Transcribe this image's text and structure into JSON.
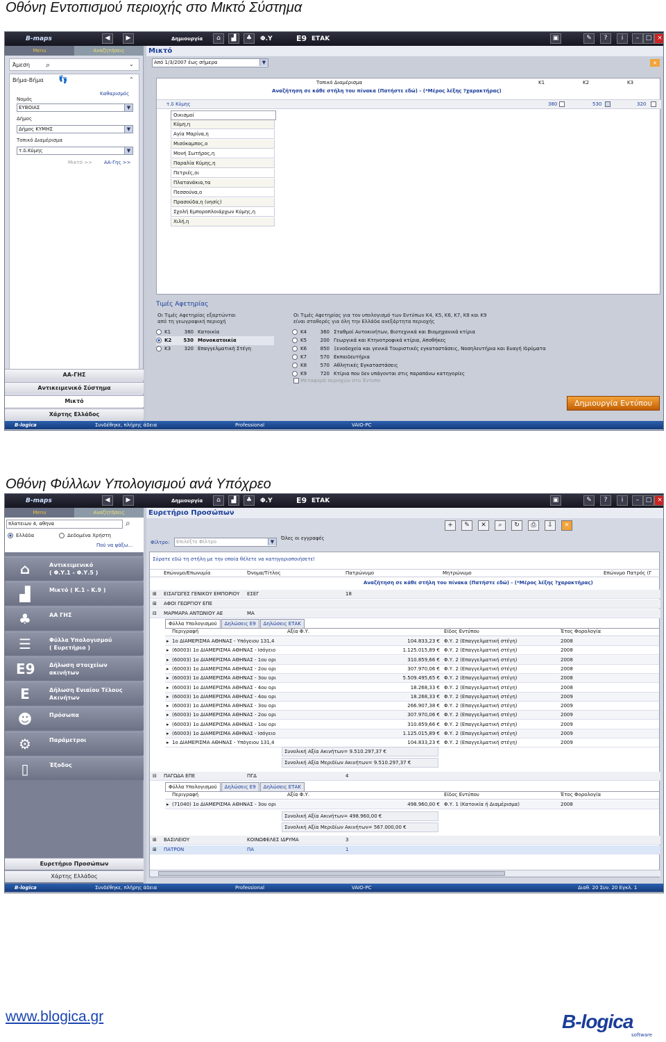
{
  "captions": {
    "first": "Οθόνη  Εντοπισμού περιοχής στο Μικτό Σύστημα",
    "second": "Οθόνη Φύλλων Υπολογισμού ανά Υπόχρεο"
  },
  "app": {
    "logo": "B-maps",
    "create_label": "Δημιουργία",
    "toolbar_fy": "Φ.Υ",
    "toolbar_e9": "E9",
    "toolbar_etak": "ΕΤΑΚ",
    "tabs": [
      "Menu",
      "Αναζητήσεις"
    ]
  },
  "screen1": {
    "left": {
      "search_mode": "Άμεση",
      "step_mode": "Βήμα-Βήμα",
      "clear": "Καθαρισμός",
      "nomos_label": "Νομός",
      "nomos_value": "ΕΥΒΟΙΑΣ",
      "dimos_label": "Δήμος",
      "dimos_value": "Δήμος ΚΥΜΗΣ",
      "td_label": "Τοπικό Διαμέρισμα",
      "td_value": "τ.δ.Κύμης",
      "link_mikto": "Μικτό >>",
      "link_aa": "ΑΑ-Γης >>",
      "nav": [
        "ΑΑ-ΓΗΣ",
        "Αντικειμενικό Σύστημα",
        "Μικτό",
        "Χάρτης Ελλάδος"
      ]
    },
    "main": {
      "title": "Μικτό",
      "period": "Από 1/3/2007 έως σήμερα",
      "col_td": "Τοπικό Διαμέρισμα",
      "col_k1": "K1",
      "col_k2": "K2",
      "col_k3": "K3",
      "search_hint": "Αναζήτηση σε κάθε στήλη του πίνακα (Πατήστε εδώ) - (*Μέρος λέξης ?χαρακτήρας)",
      "group": "τ.δ Κύμης",
      "v1": "380",
      "v2": "530",
      "v3": "320",
      "settlements_header": "Οικισμοί",
      "settlements": [
        "Κύμη,η",
        "Αγία Μαρίνα,η",
        "Μισόκαμπος,ο",
        "Μονή Σωτήρος,η",
        "Παραλία Κύμης,η",
        "Πετριές,οι",
        "Πλατανάκια,τα",
        "Πεσσούνα,ο",
        "Πρασούδα,η (νησίς)",
        "Σχολή Εμποροπλοιάρχων Κύμης,η",
        "Χιλή,η"
      ],
      "values_title": "Τιμές Αφετηρίας",
      "values_note_left": "Οι Τιμές Αφετηρίας εξαρτώνται\nαπό τη γεωγραφική περιοχή",
      "values_note_right": "Οι Τιμές Αφετηρίας για τον υπολογισμό των Εντύπων Κ4, Κ5, Κ6, Κ7, Κ8 και Κ9\nείναι σταθερές για όλη την Ελλάδα ανεξάρτητα περιοχής",
      "left_values": [
        {
          "code": "K1",
          "val": "380",
          "desc": "Κατοικία"
        },
        {
          "code": "K2",
          "val": "530",
          "desc": "Μονοκατοικία"
        },
        {
          "code": "K3",
          "val": "320",
          "desc": "Επαγγελματική Στέγη"
        }
      ],
      "right_values": [
        {
          "code": "K4",
          "val": "360",
          "desc": "Σταθμοί Αυτοκινήτων, Βιοτεχνικά και Βιομηχανικά κτίρια"
        },
        {
          "code": "K5",
          "val": "200",
          "desc": "Γεωργικά και Κτηνοτροφικά κτίρια, Αποθήκες"
        },
        {
          "code": "K6",
          "val": "850",
          "desc": "Ξενοδοχεία και γενικά Τουριστικές εγκαταστάσεις, Νοσηλευτήρια και Ευαγή Ιδρύματα"
        },
        {
          "code": "K7",
          "val": "570",
          "desc": "Εκπαιδευτήρια"
        },
        {
          "code": "K8",
          "val": "570",
          "desc": "Αθλητικές Εγκαταστάσεις"
        },
        {
          "code": "K9",
          "val": "720",
          "desc": "Κτίρια που δεν υπάγονται στις παραπάνω κατηγορίες"
        }
      ],
      "transfer": "Μεταφορά περιοχών στο Έντυπο",
      "create_form": "Δημιουργία Εντύπου"
    }
  },
  "status": {
    "brand": "B-logica",
    "conn": "Συνδέθηκε, πλήρης άδεια",
    "edition": "Professional",
    "pc": "VAIO-PC",
    "counts": "Διαθ. 20 Συν. 20 Εγκλ. 1"
  },
  "screen2": {
    "left": {
      "address": "πλατειων 4, αθηνα",
      "opt1": "Ελλάδα",
      "opt2": "Δεδομένα Χρήστη",
      "where": "Πού να ψάξω...",
      "nav": [
        {
          "icon": "⌂",
          "name": "objective",
          "text": "Αντικειμενικό\n( Φ.Υ.1 - Φ.Υ.5 )"
        },
        {
          "icon": "▟",
          "name": "mixed",
          "text": "Μικτό   ( K.1 - K.9 )"
        },
        {
          "icon": "♣",
          "name": "aa-gis",
          "text": "ΑΑ ΓΗΣ"
        },
        {
          "icon": "☰",
          "name": "sheets",
          "text": "Φύλλα Υπολογισμού\n( Ευρετήριο )"
        },
        {
          "icon": "E9",
          "name": "e9",
          "text": "Δήλωση στοιχείων\nακινήτων"
        },
        {
          "icon": "E",
          "name": "etak",
          "text": "Δήλωση Ενιαίου Τέλους\nΑκινήτων"
        },
        {
          "icon": "☻",
          "name": "persons",
          "text": "Πρόσωπα"
        },
        {
          "icon": "⚙",
          "name": "params",
          "text": "Παράμετροι"
        },
        {
          "icon": "▯",
          "name": "exit",
          "text": "Έξοδος"
        }
      ],
      "bottom1": "Ευρετήριο Προσώπων",
      "bottom2": "Χάρτης Ελλάδος"
    },
    "main": {
      "title": "Ευρετήριο Προσώπων",
      "filter_label": "Φίλτρο:",
      "filter_placeholder": "Επιλέξτε Φίλτρο",
      "all_records": "Όλες οι εγγραφές",
      "group_hint": "Σύρατε εδώ τη στήλη με την οποία θέλετε να κατηγοριοποιήσετε!",
      "cols": [
        "Επώνυμο/Επωνυμία",
        "Όνομα/Τίτλος",
        "Πατρώνυμο",
        "Μητρώνυμο",
        "Επώνυμο Πατρός (Γ"
      ],
      "search_hint": "Αναζήτηση σε κάθε στήλη του πίνακα (Πατήστε εδώ) - (*Μέρος λέξης ?χαρακτήρας)",
      "persons": [
        {
          "name": "ΕΙΣΑΓΩΓΕΣ ΓΕΝΙΚΟΥ ΕΜΠΟΡΙΟΥ",
          "title": "ΕΣΕΓ",
          "count": "18"
        },
        {
          "name": "ΑΦΟΙ ΓΕΩΡΓΙΟΥ ΕΠΕ",
          "title": "",
          "count": ""
        },
        {
          "name": "ΜΑΡΜΑΡΑ ΑΝΤΩΝΙΟΥ ΑΕ",
          "title": "ΜΑ",
          "count": ""
        }
      ],
      "subtabs": [
        "Φύλλα Υπολογισμού",
        "Δηλώσεις Ε9",
        "Δηλώσεις ΕΤΑΚ"
      ],
      "subcols": [
        "Περιγραφή",
        "Αξία Φ.Υ.",
        "Είδος Εντύπου",
        "Έτος Φορολογία"
      ],
      "sheets": [
        [
          "1ο ΔΙΑΜΕΡΙΣΜΑ ΑΘΗΝΑΣ - Υπόγειου 131,4",
          "104.833,23 €",
          "Φ.Υ. 2 (Επαγγελματική στέγη)",
          "2008"
        ],
        [
          "(60003) 1ο ΔΙΑΜΕΡΙΣΜΑ ΑΘΗΝΑΣ - Ισόγειο",
          "1.125.015,89 €",
          "Φ.Υ. 2 (Επαγγελματική στέγη)",
          "2008"
        ],
        [
          "(60003) 1ο ΔΙΑΜΕΡΙΣΜΑ ΑΘΗΝΑΣ - 1ου ορι",
          "310.859,66 €",
          "Φ.Υ. 2 (Επαγγελματική στέγη)",
          "2008"
        ],
        [
          "(60003) 1ο ΔΙΑΜΕΡΙΣΜΑ ΑΘΗΝΑΣ - 2ου ορι",
          "307.970,06 €",
          "Φ.Υ. 2 (Επαγγελματική στέγη)",
          "2008"
        ],
        [
          "(60003) 1ο ΔΙΑΜΕΡΙΣΜΑ ΑΘΗΝΑΣ - 3ου ορι",
          "5.509.495,65 €",
          "Φ.Υ. 2 (Επαγγελματική στέγη)",
          "2008"
        ],
        [
          "(60003) 1ο ΔΙΑΜΕΡΙΣΜΑ ΑΘΗΝΑΣ - 4ου ορι",
          "18.268,33 €",
          "Φ.Υ. 2 (Επαγγελματική στέγη)",
          "2008"
        ],
        [
          "(60003) 1ο ΔΙΑΜΕΡΙΣΜΑ ΑΘΗΝΑΣ - 4ου ορι",
          "18.268,33 €",
          "Φ.Υ. 2 (Επαγγελματική στέγη)",
          "2009"
        ],
        [
          "(60003) 1ο ΔΙΑΜΕΡΙΣΜΑ ΑΘΗΝΑΣ - 3ου ορι",
          "266.907,38 €",
          "Φ.Υ. 2 (Επαγγελματική στέγη)",
          "2009"
        ],
        [
          "(60003) 1ο ΔΙΑΜΕΡΙΣΜΑ ΑΘΗΝΑΣ - 2ου ορι",
          "307.970,06 €",
          "Φ.Υ. 2 (Επαγγελματική στέγη)",
          "2009"
        ],
        [
          "(60003) 1ο ΔΙΑΜΕΡΙΣΜΑ ΑΘΗΝΑΣ - 1ου ορι",
          "310.859,66 €",
          "Φ.Υ. 2 (Επαγγελματική στέγη)",
          "2009"
        ],
        [
          "(60003) 1ο ΔΙΑΜΕΡΙΣΜΑ ΑΘΗΝΑΣ - Ισόγειο",
          "1.125.015,89 €",
          "Φ.Υ. 2 (Επαγγελματική στέγη)",
          "2009"
        ],
        [
          "1ο ΔΙΑΜΕΡΙΣΜΑ ΑΘΗΝΑΣ - Υπόγειου 131,4",
          "104.833,23 €",
          "Φ.Υ. 2 (Επαγγελματική στέγη)",
          "2009"
        ]
      ],
      "total1": "Συνολική Αξία Ακινήτων= 9.510.297,37 €",
      "total2": "Συνολική Αξία Μεριδίων Ακινήτων= 9.510.297,37 €",
      "person4": {
        "name": "ΠΑΓΩΔΑ ΕΠΕ",
        "title": "ΠΓΔ",
        "count": "4"
      },
      "sheet2": [
        "(71040) 1ο ΔΙΑΜΕΡΙΣΜΑ ΑΘΗΝΑΣ - 3ου ορι",
        "498.960,00 €",
        "Φ.Υ. 1 (Κατοικία ή Διαμέρισμα)",
        "2008"
      ],
      "total3": "Συνολική Αξία Ακινήτων= 498.960,00 €",
      "total4": "Συνολική Αξία Μεριδίων Ακινήτων= 567.000,00 €",
      "person5": {
        "name": "ΒΑΣΙΛΕΙΟΥ",
        "title": "ΚΟΙΝΩΦΕΛΕΣ ΙΔΡΥΜΑ",
        "count": "3"
      },
      "person6": {
        "name": "ΠΑΤΡΟΝ",
        "title": "ΠΑ",
        "count": "1"
      }
    }
  },
  "footer": {
    "url": "www.blogica.gr",
    "logo": "B-logica",
    "logo_sub": "software"
  }
}
